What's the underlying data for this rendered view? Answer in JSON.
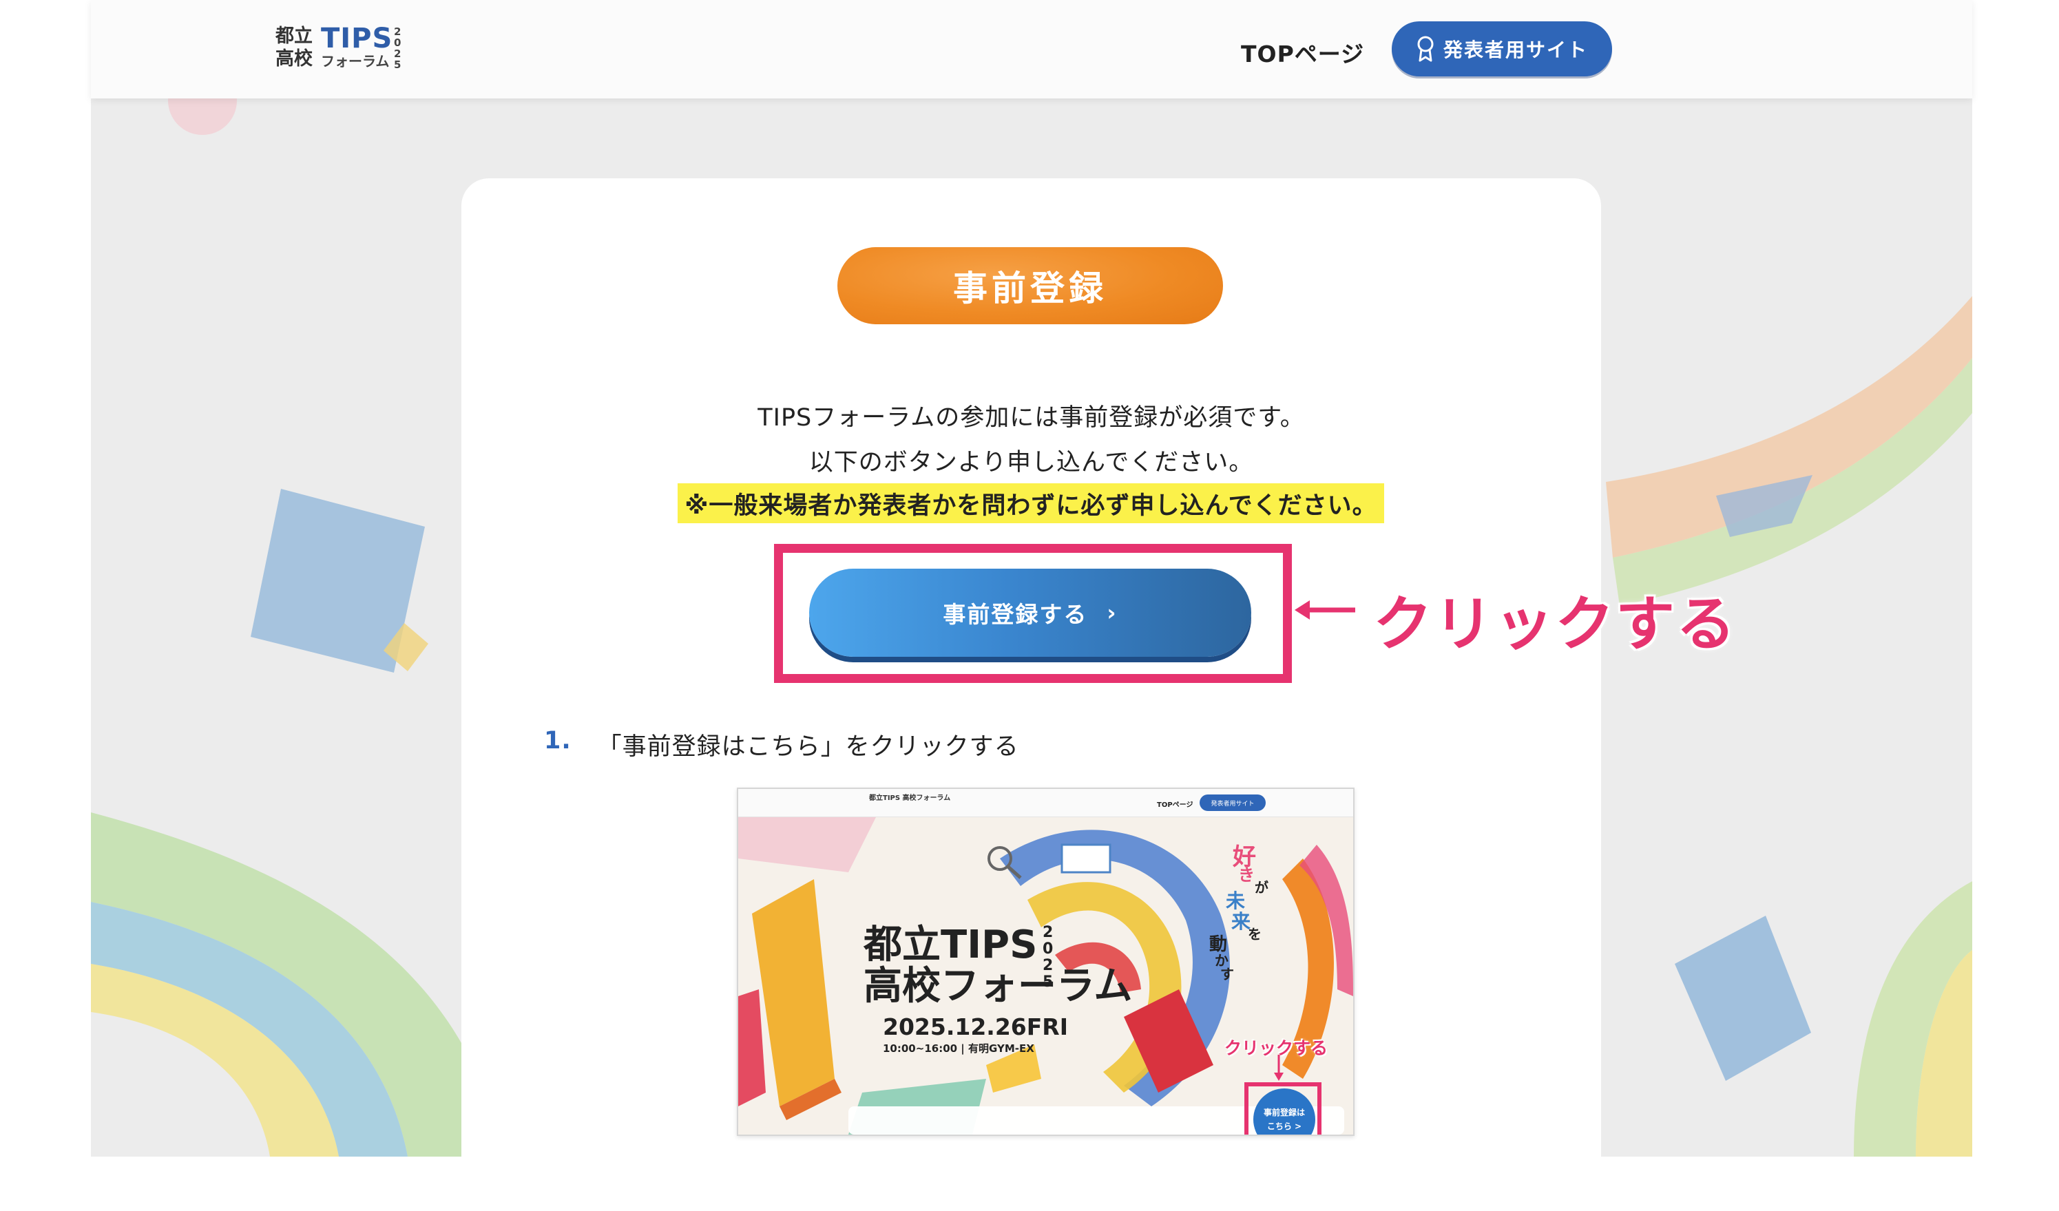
{
  "header": {
    "logo": {
      "kanji": "都立高校",
      "tips": "TIPS",
      "forum": "フォーラム",
      "year": "2025"
    },
    "nav_top": "TOPページ",
    "presenter_button": "発表者用サイト"
  },
  "main": {
    "section_title": "事前登録",
    "intro_line1": "TIPSフォーラムの参加には事前登録が必須です。",
    "intro_line2": "以下のボタンより申し込んでください。",
    "notice": "※一般来場者か発表者かを問わずに必ず申し込んでください。",
    "register_button": "事前登録する",
    "register_chevron": "›",
    "annotation": "クリックする",
    "step": {
      "number": "1.",
      "text": "「事前登録はこちら」をクリックする"
    }
  },
  "embedded_screenshot": {
    "logo": "都立TIPS 高校フォーラム",
    "nav_top": "TOPページ",
    "presenter_button": "発表者用サイト",
    "hero_title_line1": "都立TIPS",
    "hero_title_line2": "高校フォーラム",
    "hero_year": "2025",
    "date": "2025.12.26FRI",
    "time": "10:00~16:00 | 有明GYM-EX",
    "catch_1": "好",
    "catch_2": "き",
    "catch_3": "が",
    "catch_4": "未",
    "catch_5": "来",
    "catch_6": "を",
    "catch_7": "動",
    "catch_8": "か",
    "catch_9": "す",
    "annotation": "クリックする",
    "button_line1": "事前登録は",
    "button_line2": "こちら >"
  },
  "colors": {
    "accent_blue": "#2f66b8",
    "orange": "#ef8a24",
    "pink": "#e6336f",
    "highlight_yellow": "#fbf14a"
  }
}
